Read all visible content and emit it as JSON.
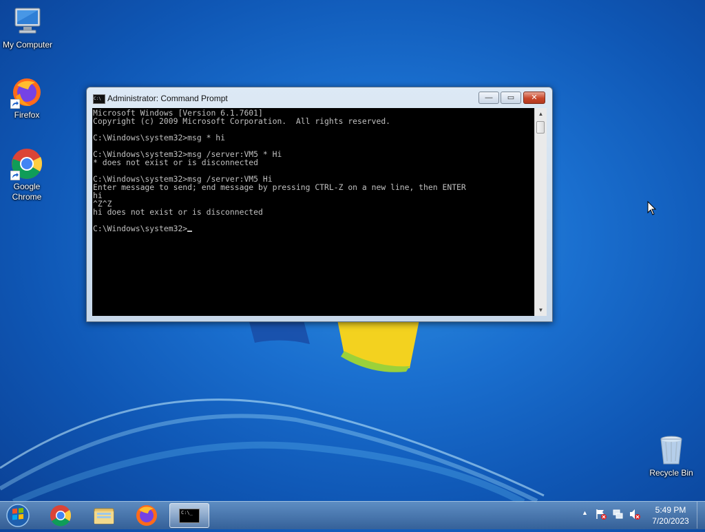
{
  "desktop": {
    "icons": [
      {
        "label": "My Computer",
        "icon": "my-computer-icon"
      },
      {
        "label": "Firefox",
        "icon": "firefox-icon"
      },
      {
        "label": "Google\nChrome",
        "icon": "chrome-icon"
      },
      {
        "label": "Recycle Bin",
        "icon": "recycle-bin-icon"
      }
    ]
  },
  "window": {
    "title": "Administrator: Command Prompt",
    "minimize_glyph": "—",
    "maximize_glyph": "▭",
    "close_glyph": "✕",
    "console_lines": [
      "Microsoft Windows [Version 6.1.7601]",
      "Copyright (c) 2009 Microsoft Corporation.  All rights reserved.",
      "",
      "C:\\Windows\\system32>msg * hi",
      "",
      "C:\\Windows\\system32>msg /server:VM5 * Hi",
      "* does not exist or is disconnected",
      "",
      "C:\\Windows\\system32>msg /server:VM5 Hi",
      "Enter message to send; end message by pressing CTRL-Z on a new line, then ENTER",
      "hi",
      "^Z^Z",
      "hi does not exist or is disconnected",
      ""
    ],
    "prompt": "C:\\Windows\\system32>"
  },
  "taskbar": {
    "items": [
      "start-orb",
      "chrome",
      "file-explorer",
      "firefox",
      "command-prompt"
    ],
    "cmd_icon_text": "C:\\_",
    "tray": {
      "show_hidden_glyph": "▲"
    },
    "clock": {
      "time": "5:49 PM",
      "date": "7/20/2023"
    }
  },
  "colors": {
    "console_bg": "#000000",
    "console_fg": "#c0c0c0",
    "wallpaper": "#1a6fcf"
  }
}
